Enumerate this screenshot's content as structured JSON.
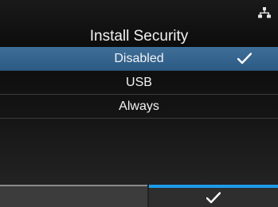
{
  "header": {
    "title": "Install Security",
    "status_icon": "network-icon"
  },
  "menu": {
    "items": [
      {
        "label": "Disabled",
        "selected": true,
        "checked": true
      },
      {
        "label": "USB",
        "selected": false,
        "checked": false
      },
      {
        "label": "Always",
        "selected": false,
        "checked": false
      }
    ]
  },
  "softkeys": {
    "left": {
      "icon": "",
      "label": ""
    },
    "right": {
      "icon": "check-icon"
    }
  },
  "colors": {
    "selection": "#2f5f8a",
    "accent": "#1e9be8",
    "background": "#111111",
    "text": "#f2f2f2"
  }
}
